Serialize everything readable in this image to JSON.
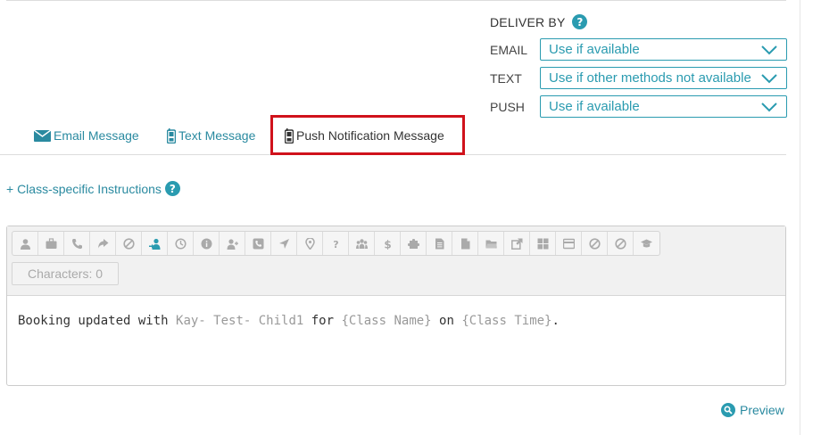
{
  "deliver": {
    "title": "DELIVER BY",
    "help": "?",
    "rows": [
      {
        "label": "EMAIL",
        "value": "Use if available"
      },
      {
        "label": "TEXT",
        "value": "Use if other methods not available"
      },
      {
        "label": "PUSH",
        "value": "Use if available"
      }
    ]
  },
  "tabs": [
    {
      "label": "Email Message",
      "icon": "envelope-icon"
    },
    {
      "label": "Text Message",
      "icon": "phone-icon"
    },
    {
      "label": "Push Notification Message",
      "icon": "phone-icon",
      "active": true
    }
  ],
  "class_instructions": {
    "label": "+ Class-specific Instructions",
    "help": "?"
  },
  "toolbar": {
    "icons": [
      "user-icon",
      "briefcase-icon",
      "phone-icon",
      "share-icon",
      "ban-icon",
      "assign-user-icon",
      "clock-icon",
      "info-icon",
      "add-user-icon",
      "phone-square-icon",
      "location-arrow-icon",
      "map-marker-icon",
      "question-icon",
      "group-icon",
      "dollar-icon",
      "puzzle-icon",
      "document-icon",
      "file-icon",
      "folder-icon",
      "external-link-icon",
      "grid-icon",
      "credit-card-icon",
      "ban-icon",
      "ban-icon",
      "graduation-cap-icon"
    ],
    "active_index": 5,
    "characters": "Characters: 0"
  },
  "message": {
    "part1": "Booking updated with ",
    "child": "Kay- Test- Child1",
    "part2": " for ",
    "class_name": "{Class Name}",
    "part3": " on ",
    "class_time": "{Class Time}",
    "part4": "."
  },
  "preview": {
    "label": "Preview"
  },
  "colors": {
    "accent": "#2a9bb0",
    "highlight": "#d0121b"
  }
}
